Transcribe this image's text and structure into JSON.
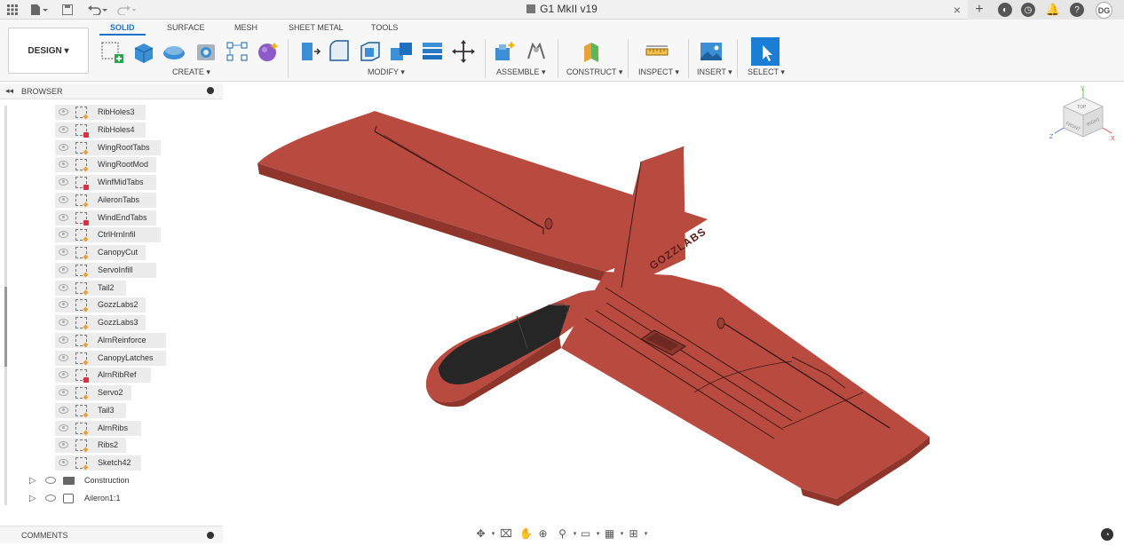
{
  "app": {
    "document_title": "G1 MkII v19",
    "user_initials": "DG"
  },
  "ribbon": {
    "workspace_button": "DESIGN ▾",
    "tabs": [
      "SOLID",
      "SURFACE",
      "MESH",
      "SHEET METAL",
      "TOOLS"
    ],
    "active_tab": "SOLID",
    "groups": [
      "CREATE ▾",
      "MODIFY ▾",
      "ASSEMBLE ▾",
      "CONSTRUCT ▾",
      "INSPECT ▾",
      "INSERT ▾",
      "SELECT ▾"
    ]
  },
  "browser": {
    "title": "BROWSER",
    "sketches": [
      {
        "label": "RibHoles3",
        "locked": false
      },
      {
        "label": "RibHoles4",
        "locked": true
      },
      {
        "label": "WingRootTabs",
        "locked": false
      },
      {
        "label": "WingRootMod",
        "locked": false
      },
      {
        "label": "WinfMidTabs",
        "locked": true
      },
      {
        "label": "AileronTabs",
        "locked": false
      },
      {
        "label": "WindEndTabs",
        "locked": true
      },
      {
        "label": "CtrlHrnInfil",
        "locked": false
      },
      {
        "label": "CanopyCut",
        "locked": false
      },
      {
        "label": "ServoInfill",
        "locked": false
      },
      {
        "label": "Tail2",
        "locked": false
      },
      {
        "label": "GozzLabs2",
        "locked": false
      },
      {
        "label": "GozzLabs3",
        "locked": false
      },
      {
        "label": "AlrnReinforce",
        "locked": false
      },
      {
        "label": "CanopyLatches",
        "locked": false
      },
      {
        "label": "AlrnRibRef",
        "locked": true
      },
      {
        "label": "Servo2",
        "locked": false
      },
      {
        "label": "Tail3",
        "locked": false
      },
      {
        "label": "AlrnRibs",
        "locked": false
      },
      {
        "label": "Ribs2",
        "locked": false
      },
      {
        "label": "Sketch42",
        "locked": false
      }
    ],
    "folders": [
      {
        "label": "Construction",
        "icon": "folder-icon"
      },
      {
        "label": "Aileron1:1",
        "icon": "component-icon"
      }
    ]
  },
  "comments": {
    "title": "COMMENTS"
  },
  "model": {
    "tail_text": "GOZZLABS",
    "colors": {
      "body": "#b84a3f",
      "body_light": "#c75a4d",
      "body_dark": "#8f352c",
      "canopy": "#2a2a2a"
    }
  },
  "viewcube": {
    "faces": [
      "TOP",
      "FRONT",
      "RIGHT"
    ],
    "axes": [
      "Y",
      "Z",
      "X"
    ]
  }
}
